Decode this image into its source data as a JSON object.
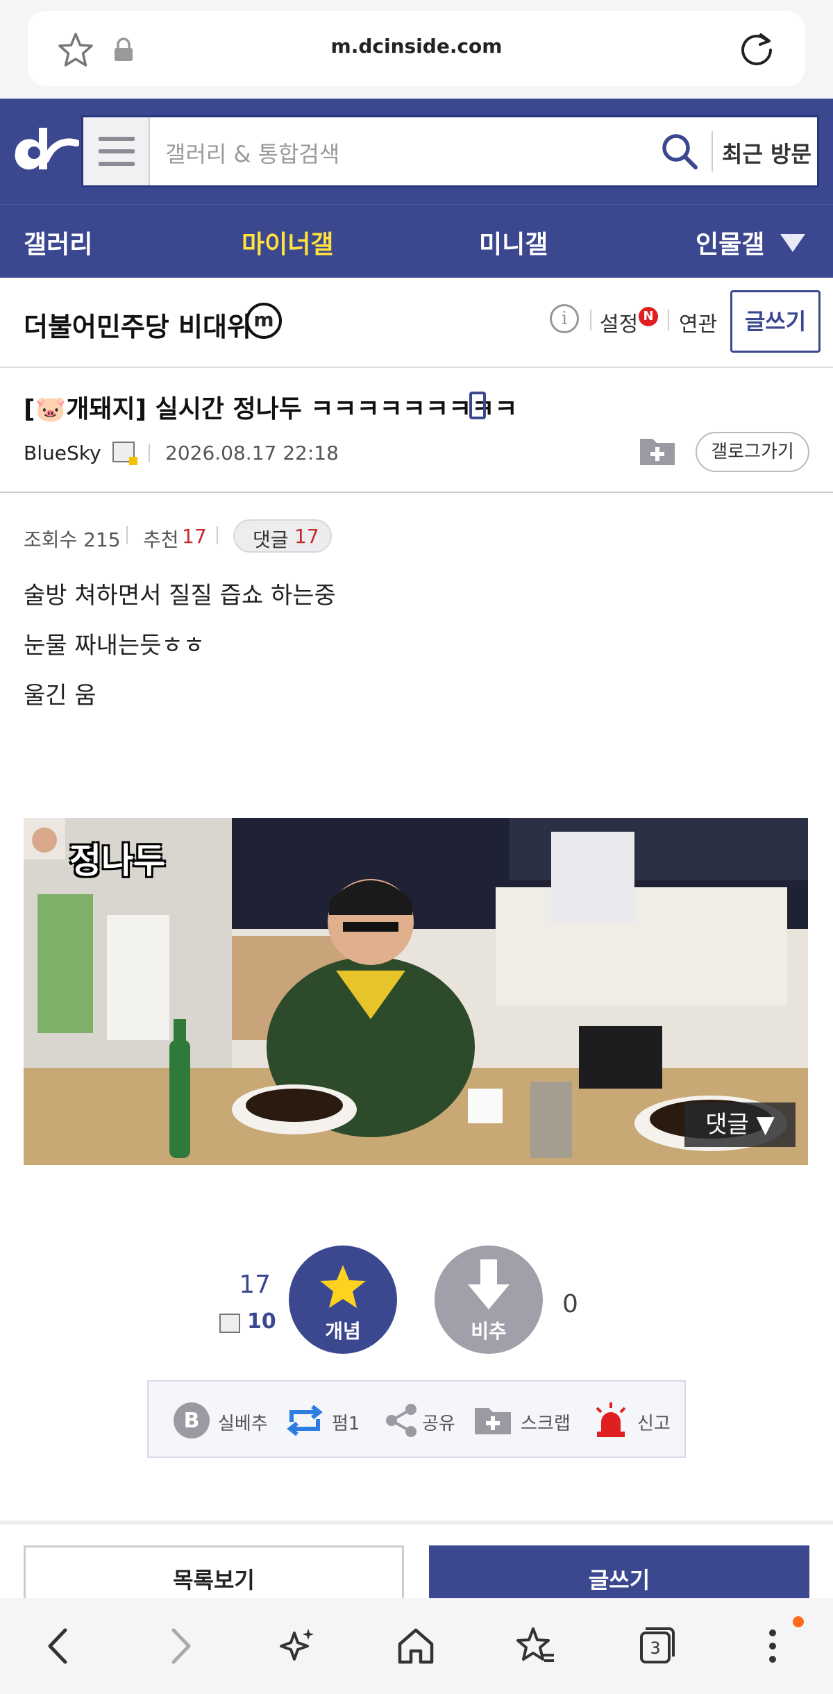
{
  "browser": {
    "url": "m.dcinside.com",
    "tab_count": "3"
  },
  "header": {
    "search_placeholder": "갤러리 & 통합검색",
    "recent_label": "최근 방문"
  },
  "nav": {
    "items": [
      {
        "label": "갤러리",
        "active": false
      },
      {
        "label": "마이너갤",
        "active": true
      },
      {
        "label": "미니갤",
        "active": false
      },
      {
        "label": "인물갤",
        "active": false
      }
    ]
  },
  "gallery": {
    "title": "더불어민주당 비대위",
    "badge": "m",
    "settings_label": "설정",
    "new_badge": "N",
    "related_label": "연관",
    "write_label": "글쓰기"
  },
  "post": {
    "title": "[🐷개돼지] 실시간 정나두 ㅋㅋㅋㅋㅋㅋㅋㅋㅋ",
    "author": "BlueSky",
    "date": "2026.08.17 22:18",
    "gallog_label": "갤로그가기",
    "views_label": "조회수 215",
    "recommend_label": "추천",
    "recommend_count": "17",
    "comment_label": "댓글",
    "comment_count": "17",
    "body": [
      "술방 쳐하면서 질질 즙쇼 하는중",
      "눈물 짜내는듯ㅎㅎ",
      "울긴 움"
    ],
    "image_caption": "정나두",
    "image_comment_btn": "댓글 ▼"
  },
  "vote": {
    "up_count": "17",
    "fixed_count": "10",
    "up_label": "개념",
    "down_label": "비추",
    "down_count": "0"
  },
  "actions": [
    {
      "label": "실베추",
      "icon": "b-badge-icon"
    },
    {
      "label": "펌1",
      "icon": "repost-icon"
    },
    {
      "label": "공유",
      "icon": "share-icon"
    },
    {
      "label": "스크랩",
      "icon": "scrap-folder-icon"
    },
    {
      "label": "신고",
      "icon": "siren-icon"
    }
  ],
  "footer_buttons": {
    "list_label": "목록보기",
    "write_label": "글쓰기"
  },
  "colors": {
    "brand": "#3b4890",
    "active_nav": "#ffe23a",
    "red": "#c92a2a"
  }
}
